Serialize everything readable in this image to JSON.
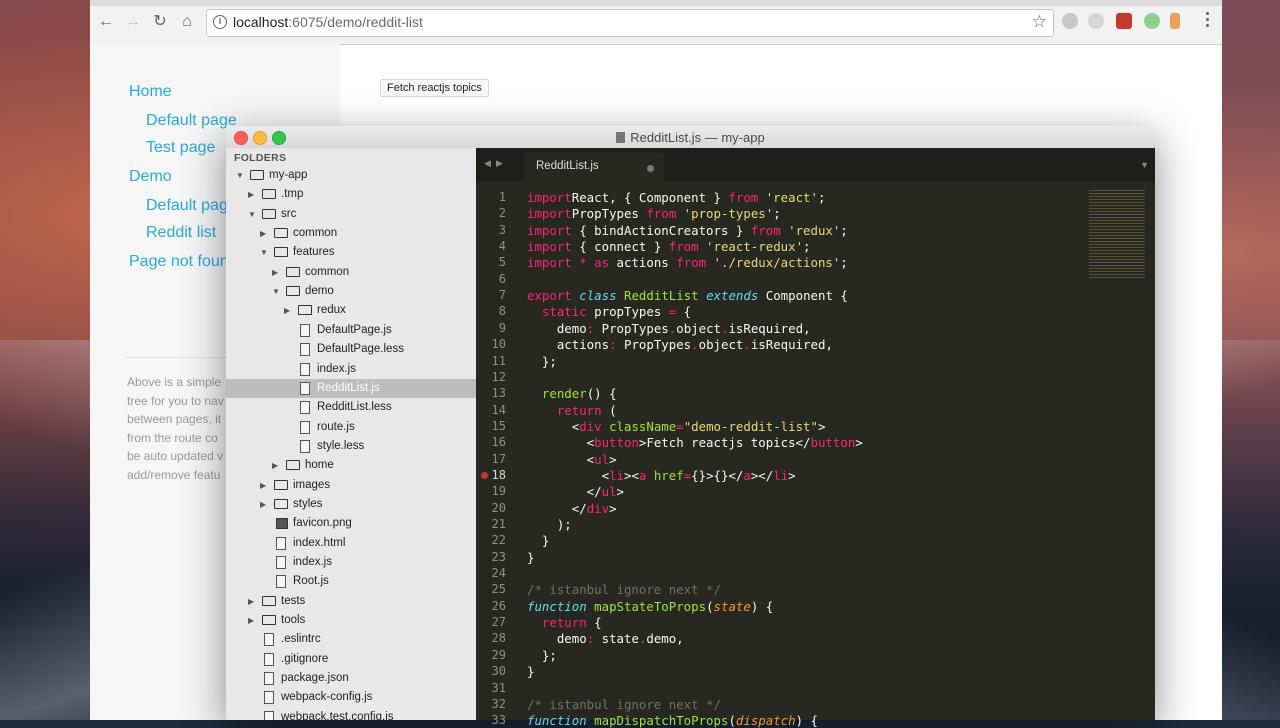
{
  "browser": {
    "url_host": "localhost",
    "url_rest": ":6075/demo/reddit-list",
    "nav": {
      "back": "←",
      "forward": "→",
      "reload": "↻",
      "home": "⌂"
    },
    "star": "☆"
  },
  "page": {
    "links": [
      "Home",
      "Default page",
      "Test page",
      "Demo",
      "Default page",
      "Reddit list",
      "Page not found"
    ],
    "description_lines": [
      "Above is a simple",
      "tree for you to nav",
      "between pages, it",
      "from the route co",
      "be auto updated v",
      "add/remove featu"
    ],
    "fetch_button": "Fetch reactjs topics"
  },
  "editor": {
    "window_title": "RedditList.js — my-app",
    "folders_header": "FOLDERS",
    "tab_name": "RedditList.js",
    "tree": [
      {
        "label": "my-app",
        "depth": 0,
        "type": "folder",
        "open": true
      },
      {
        "label": ".tmp",
        "depth": 1,
        "type": "folder",
        "open": false
      },
      {
        "label": "src",
        "depth": 1,
        "type": "folder",
        "open": true
      },
      {
        "label": "common",
        "depth": 2,
        "type": "folder",
        "open": false
      },
      {
        "label": "features",
        "depth": 2,
        "type": "folder",
        "open": true
      },
      {
        "label": "common",
        "depth": 3,
        "type": "folder",
        "open": false
      },
      {
        "label": "demo",
        "depth": 3,
        "type": "folder",
        "open": true
      },
      {
        "label": "redux",
        "depth": 4,
        "type": "folder",
        "open": false
      },
      {
        "label": "DefaultPage.js",
        "depth": 4,
        "type": "file"
      },
      {
        "label": "DefaultPage.less",
        "depth": 4,
        "type": "file"
      },
      {
        "label": "index.js",
        "depth": 4,
        "type": "file"
      },
      {
        "label": "RedditList.js",
        "depth": 4,
        "type": "file",
        "selected": true
      },
      {
        "label": "RedditList.less",
        "depth": 4,
        "type": "file"
      },
      {
        "label": "route.js",
        "depth": 4,
        "type": "file"
      },
      {
        "label": "style.less",
        "depth": 4,
        "type": "file"
      },
      {
        "label": "home",
        "depth": 3,
        "type": "folder",
        "open": false
      },
      {
        "label": "images",
        "depth": 2,
        "type": "folder",
        "open": false
      },
      {
        "label": "styles",
        "depth": 2,
        "type": "folder",
        "open": false
      },
      {
        "label": "favicon.png",
        "depth": 2,
        "type": "image"
      },
      {
        "label": "index.html",
        "depth": 2,
        "type": "file"
      },
      {
        "label": "index.js",
        "depth": 2,
        "type": "file"
      },
      {
        "label": "Root.js",
        "depth": 2,
        "type": "file"
      },
      {
        "label": "tests",
        "depth": 1,
        "type": "folder",
        "open": false
      },
      {
        "label": "tools",
        "depth": 1,
        "type": "folder",
        "open": false
      },
      {
        "label": ".eslintrc",
        "depth": 1,
        "type": "file"
      },
      {
        "label": ".gitignore",
        "depth": 1,
        "type": "file"
      },
      {
        "label": "package.json",
        "depth": 1,
        "type": "file"
      },
      {
        "label": "webpack-config.js",
        "depth": 1,
        "type": "file"
      },
      {
        "label": "webpack.test.config.js",
        "depth": 1,
        "type": "file"
      }
    ],
    "current_line": 18,
    "code": [
      [
        [
          "k",
          "import"
        ],
        [
          "",
          "React, { Component } "
        ],
        [
          "k",
          "from"
        ],
        [
          "",
          ""
        ],
        [
          "s",
          " 'react'"
        ],
        [
          "",
          ";"
        ]
      ],
      [
        [
          "k",
          "import"
        ],
        [
          "",
          "PropTypes "
        ],
        [
          "k",
          "from"
        ],
        [
          "s",
          " 'prop-types'"
        ],
        [
          "",
          ";"
        ]
      ],
      [
        [
          "k",
          "import"
        ],
        [
          "",
          {
            "v": " { bindActionCreators } "
          }
        ],
        [
          "k",
          "from"
        ],
        [
          "s",
          " 'redux'"
        ],
        [
          "",
          ";"
        ]
      ],
      [
        [
          "k",
          "import"
        ],
        [
          "",
          {
            "v": " { connect } "
          }
        ],
        [
          "k",
          "from"
        ],
        [
          "s",
          " 'react-redux'"
        ],
        [
          "",
          ";"
        ]
      ],
      [
        [
          "k",
          "import"
        ],
        [
          "",
          {
            "v": " "
          }
        ],
        [
          "k",
          "*"
        ],
        [
          "",
          {
            "v": " "
          }
        ],
        [
          "k",
          "as"
        ],
        [
          "",
          {
            "v": " actions "
          }
        ],
        [
          "k",
          "from"
        ],
        [
          "s",
          " './redux/actions'"
        ],
        [
          "",
          ";"
        ]
      ],
      [],
      [
        [
          "k",
          "export"
        ],
        [
          "",
          {
            "v": " "
          }
        ],
        [
          "t",
          "class"
        ],
        [
          "",
          {
            "v": " "
          }
        ],
        [
          "f",
          "RedditList"
        ],
        [
          "",
          {
            "v": " "
          }
        ],
        [
          "t",
          "extends"
        ],
        [
          "",
          {
            "v": " Component {"
          }
        ]
      ],
      [
        [
          "",
          {
            "v": "  "
          }
        ],
        [
          "k",
          "static"
        ],
        [
          "",
          {
            "v": " propTypes "
          }
        ],
        [
          "k",
          "="
        ],
        [
          "",
          {
            "v": " {"
          }
        ]
      ],
      [
        [
          "",
          {
            "v": "    demo"
          }
        ],
        [
          "k",
          ":"
        ],
        [
          "",
          {
            "v": " PropTypes"
          }
        ],
        [
          "k",
          "."
        ],
        [
          "",
          {
            "v": "object"
          }
        ],
        [
          "k",
          "."
        ],
        [
          "",
          {
            "v": "isRequired,"
          }
        ]
      ],
      [
        [
          "",
          {
            "v": "    actions"
          }
        ],
        [
          "k",
          ":"
        ],
        [
          "",
          {
            "v": " PropTypes"
          }
        ],
        [
          "k",
          "."
        ],
        [
          "",
          {
            "v": "object"
          }
        ],
        [
          "k",
          "."
        ],
        [
          "",
          {
            "v": "isRequired,"
          }
        ]
      ],
      [
        [
          "",
          {
            "v": "  };"
          }
        ]
      ],
      [],
      [
        [
          "",
          {
            "v": "  "
          }
        ],
        [
          "f",
          "render"
        ],
        [
          "",
          {
            "v": "() {"
          }
        ]
      ],
      [
        [
          "",
          {
            "v": "    "
          }
        ],
        [
          "k",
          "return"
        ],
        [
          "",
          {
            "v": " ("
          }
        ]
      ],
      [
        [
          "",
          {
            "v": "      <"
          }
        ],
        [
          "k",
          "div"
        ],
        [
          "",
          {
            "v": " "
          }
        ],
        [
          "f",
          "className"
        ],
        [
          "k",
          "="
        ],
        [
          "s",
          "\"demo-reddit-list\""
        ],
        [
          "",
          {
            "v": ">"
          }
        ]
      ],
      [
        [
          "",
          {
            "v": "        <"
          }
        ],
        [
          "k",
          "button"
        ],
        [
          "",
          {
            "v": ">Fetch reactjs topics</"
          }
        ],
        [
          "k",
          "button"
        ],
        [
          "",
          {
            "v": ">"
          }
        ]
      ],
      [
        [
          "",
          {
            "v": "        <"
          }
        ],
        [
          "k",
          "ul"
        ],
        [
          "",
          {
            "v": ">"
          }
        ]
      ],
      [
        [
          "",
          {
            "v": "          <"
          }
        ],
        [
          "k",
          "li"
        ],
        [
          "",
          {
            "v": "><"
          }
        ],
        [
          "k",
          "a"
        ],
        [
          "",
          {
            "v": " "
          }
        ],
        [
          "f",
          "href"
        ],
        [
          "k",
          "="
        ],
        [
          "",
          {
            "v": "{}>{}</"
          }
        ],
        [
          "k",
          "a"
        ],
        [
          "",
          {
            "v": "></"
          }
        ],
        [
          "k",
          "li"
        ],
        [
          "",
          {
            "v": ">"
          }
        ]
      ],
      [
        [
          "",
          {
            "v": "        </"
          }
        ],
        [
          "k",
          "ul"
        ],
        [
          "",
          {
            "v": ">"
          }
        ]
      ],
      [
        [
          "",
          {
            "v": "      </"
          }
        ],
        [
          "k",
          "div"
        ],
        [
          "",
          {
            "v": ">"
          }
        ]
      ],
      [
        [
          "",
          {
            "v": "    );"
          }
        ]
      ],
      [
        [
          "",
          {
            "v": "  }"
          }
        ]
      ],
      [
        [
          "",
          {
            "v": "}"
          }
        ]
      ],
      [],
      [
        [
          "c",
          "/* istanbul ignore next */"
        ]
      ],
      [
        [
          "t",
          "function"
        ],
        [
          "",
          {
            "v": " "
          }
        ],
        [
          "f",
          "mapStateToProps"
        ],
        [
          "",
          {
            "v": "("
          }
        ],
        [
          "p",
          "state"
        ],
        [
          "",
          {
            "v": ") {"
          }
        ]
      ],
      [
        [
          "",
          {
            "v": "  "
          }
        ],
        [
          "k",
          "return"
        ],
        [
          "",
          {
            "v": " {"
          }
        ]
      ],
      [
        [
          "",
          {
            "v": "    demo"
          }
        ],
        [
          "k",
          ":"
        ],
        [
          "",
          {
            "v": " state"
          }
        ],
        [
          "k",
          "."
        ],
        [
          "",
          {
            "v": "demo,"
          }
        ]
      ],
      [
        [
          "",
          {
            "v": "  };"
          }
        ]
      ],
      [
        [
          "",
          {
            "v": "}"
          }
        ]
      ],
      [],
      [
        [
          "c",
          "/* istanbul ignore next */"
        ]
      ],
      [
        [
          "t",
          "function"
        ],
        [
          "",
          {
            "v": " "
          }
        ],
        [
          "f",
          "mapDispatchToProps"
        ],
        [
          "",
          {
            "v": "("
          }
        ],
        [
          "p",
          "dispatch"
        ],
        [
          "",
          {
            "v": ") {"
          }
        ]
      ]
    ]
  },
  "colors": {
    "link": "#28a9e0",
    "editor_bg": "#272822",
    "keyword": "#f92672",
    "string": "#e6db74",
    "function": "#a6e22e",
    "comment": "#75715e",
    "type": "#66d9ef",
    "param": "#fd971f"
  }
}
